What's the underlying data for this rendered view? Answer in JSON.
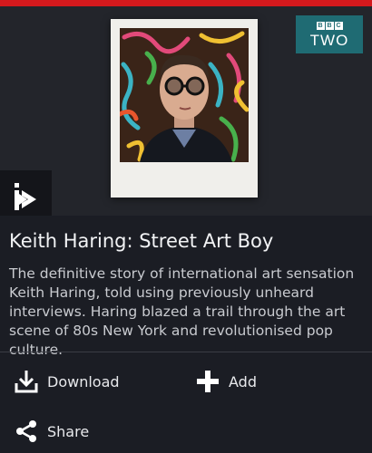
{
  "header": {
    "accent_color": "#d4191d"
  },
  "channel_badge": {
    "bbc_letters": [
      "B",
      "B",
      "C"
    ],
    "channel": "TWO",
    "color": "#1f6b73"
  },
  "hero": {
    "image_subject": "polaroid-portrait"
  },
  "programme": {
    "title": "Keith Haring: Street Art Boy",
    "description": "The definitive story of international art sensation Keith Haring, told using previously unheard interviews. Haring blazed a trail through the art scene of 80s New York and revolutionised pop culture."
  },
  "actions": {
    "download": {
      "label": "Download",
      "icon": "download-icon"
    },
    "add": {
      "label": "Add",
      "icon": "plus-icon"
    },
    "share": {
      "label": "Share",
      "icon": "share-icon"
    }
  }
}
